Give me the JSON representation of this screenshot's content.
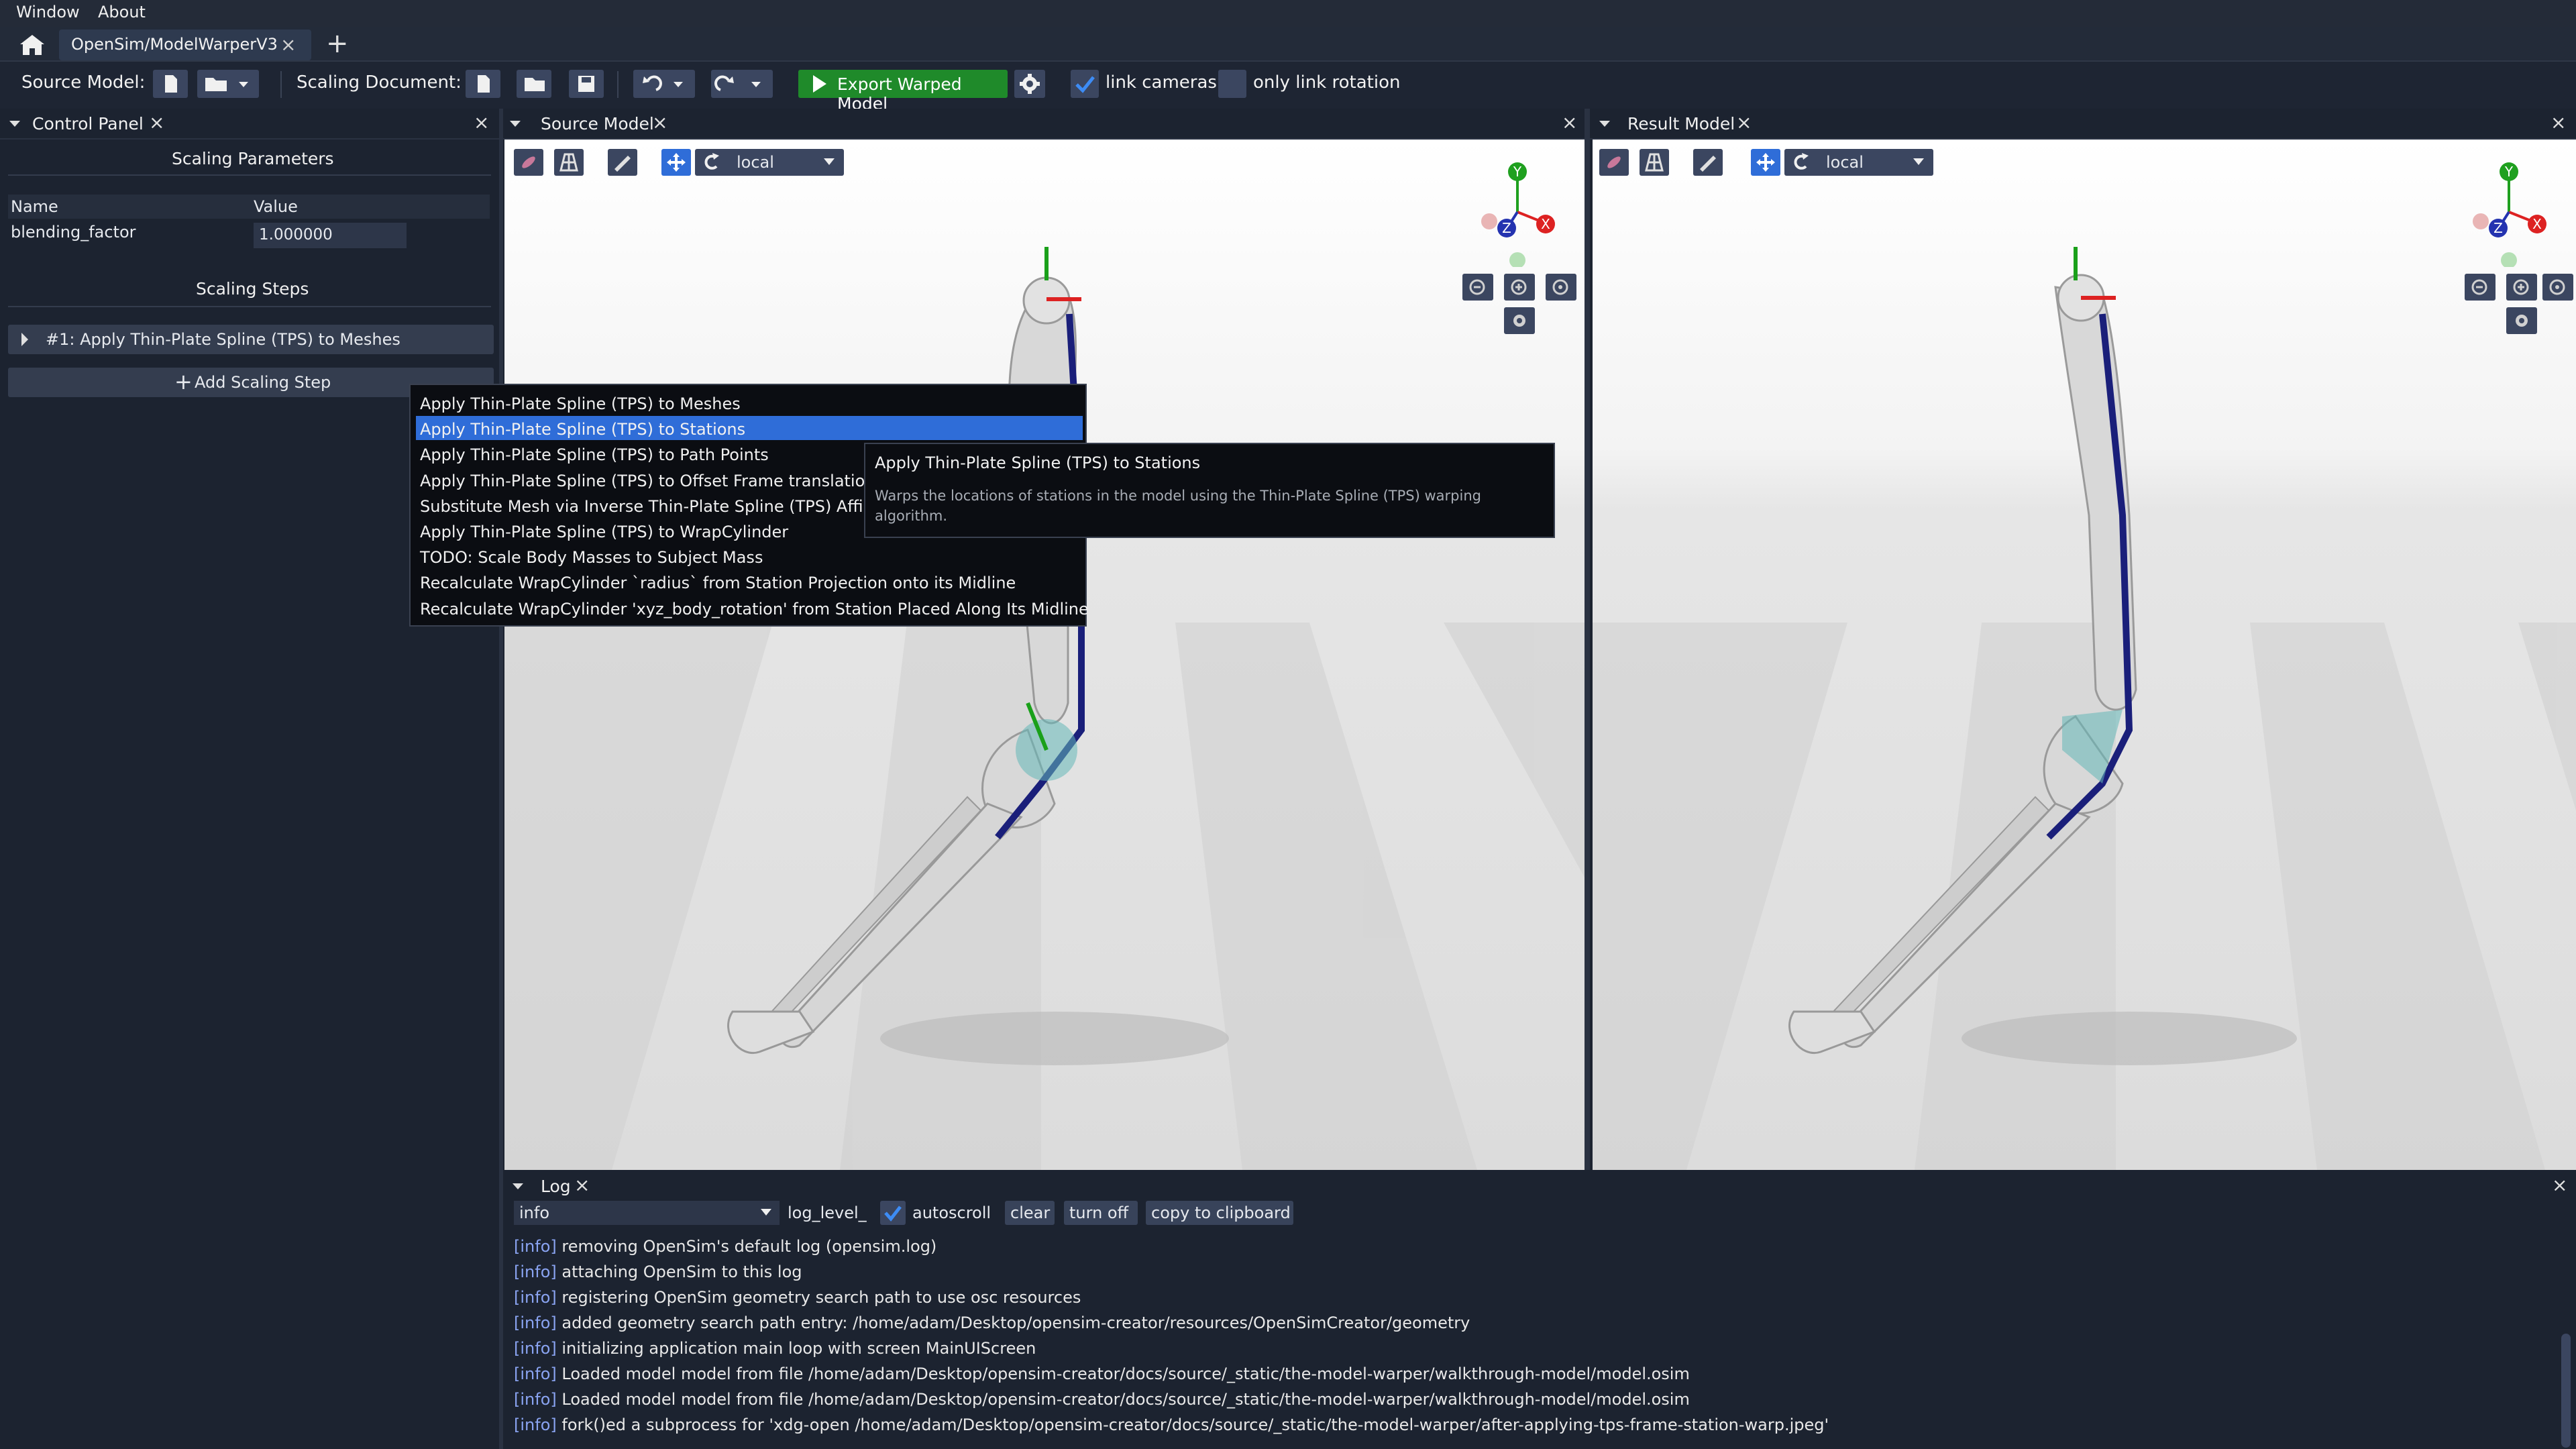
{
  "menubar": {
    "items": [
      "Window",
      "About"
    ]
  },
  "tabs": {
    "active_label": "OpenSim/ModelWarperV3",
    "close": "×",
    "add": "+"
  },
  "toolbar": {
    "source_model_label": "Source Model:",
    "scaling_document_label": "Scaling Document:",
    "export_label": "Export Warped Model",
    "link_cameras_label": "link cameras",
    "only_link_rotation_label": "only link rotation",
    "link_cameras_checked": true,
    "only_link_rotation_checked": false
  },
  "control_panel": {
    "title": "Control Panel",
    "scaling_parameters_title": "Scaling Parameters",
    "col_name": "Name",
    "col_value": "Value",
    "param_name": "blending_factor",
    "param_value": "1.000000",
    "scaling_steps_title": "Scaling Steps",
    "step_1": "#1: Apply Thin-Plate Spline (TPS) to Meshes",
    "add_step_label": "Add Scaling Step"
  },
  "source_viewport": {
    "title": "Source Model",
    "frame_mode": "local"
  },
  "result_viewport": {
    "title": "Result Model",
    "frame_mode": "local"
  },
  "axis_labels": {
    "x": "X",
    "y": "Y",
    "z": "Z"
  },
  "popup": {
    "items": [
      "Apply Thin-Plate Spline (TPS) to Meshes",
      "Apply Thin-Plate Spline (TPS) to Stations",
      "Apply Thin-Plate Spline (TPS) to Path Points",
      "Apply Thin-Plate Spline (TPS) to Offset Frame translation",
      "Substitute Mesh via Inverse Thin-Plate Spline (TPS) Affine",
      "Apply Thin-Plate Spline (TPS) to WrapCylinder",
      "TODO: Scale Body Masses to Subject Mass",
      "Recalculate WrapCylinder `radius` from Station Projection onto its Midline",
      "Recalculate WrapCylinder 'xyz_body_rotation' from Station Placed Along Its Midline"
    ],
    "highlighted_index": 1
  },
  "tooltip": {
    "title": "Apply Thin-Plate Spline (TPS) to Stations",
    "description": "Warps the locations of stations in the model using the Thin-Plate Spline (TPS) warping algorithm."
  },
  "log": {
    "title": "Log",
    "level_value": "info",
    "level_label": "log_level_",
    "autoscroll_label": "autoscroll",
    "autoscroll_checked": true,
    "clear_label": "clear",
    "turn_off_label": "turn off",
    "copy_label": "copy to clipboard",
    "lines": [
      {
        "tag": "[info]",
        "text": "removing OpenSim's default log (opensim.log)"
      },
      {
        "tag": "[info]",
        "text": "attaching OpenSim to this log"
      },
      {
        "tag": "[info]",
        "text": "registering OpenSim geometry search path to use osc resources"
      },
      {
        "tag": "[info]",
        "text": "added geometry search path entry: /home/adam/Desktop/opensim-creator/resources/OpenSimCreator/geometry"
      },
      {
        "tag": "[info]",
        "text": "initializing application main loop with screen MainUIScreen"
      },
      {
        "tag": "[info]",
        "text": "Loaded model model from file /home/adam/Desktop/opensim-creator/docs/source/_static/the-model-warper/walkthrough-model/model.osim"
      },
      {
        "tag": "[info]",
        "text": "Loaded model model from file /home/adam/Desktop/opensim-creator/docs/source/_static/the-model-warper/walkthrough-model/model.osim"
      },
      {
        "tag": "[info]",
        "text": "fork()ed a subprocess for 'xdg-open /home/adam/Desktop/opensim-creator/docs/source/_static/the-model-warper/after-applying-tps-frame-station-warp.jpeg'"
      }
    ]
  },
  "colors": {
    "accent_blue": "#2f6dd8",
    "export_green": "#1f8a2a",
    "bone": "#d8d8d8",
    "muscle": "#1a1f7a"
  },
  "icons": {
    "home": "home-icon",
    "new_file": "new-file-icon",
    "open_folder": "folder-open-icon",
    "save": "save-icon",
    "undo": "undo-icon",
    "redo": "redo-icon",
    "play": "play-icon",
    "settings": "gear-icon",
    "move": "move-icon",
    "rotate": "rotate-icon"
  }
}
